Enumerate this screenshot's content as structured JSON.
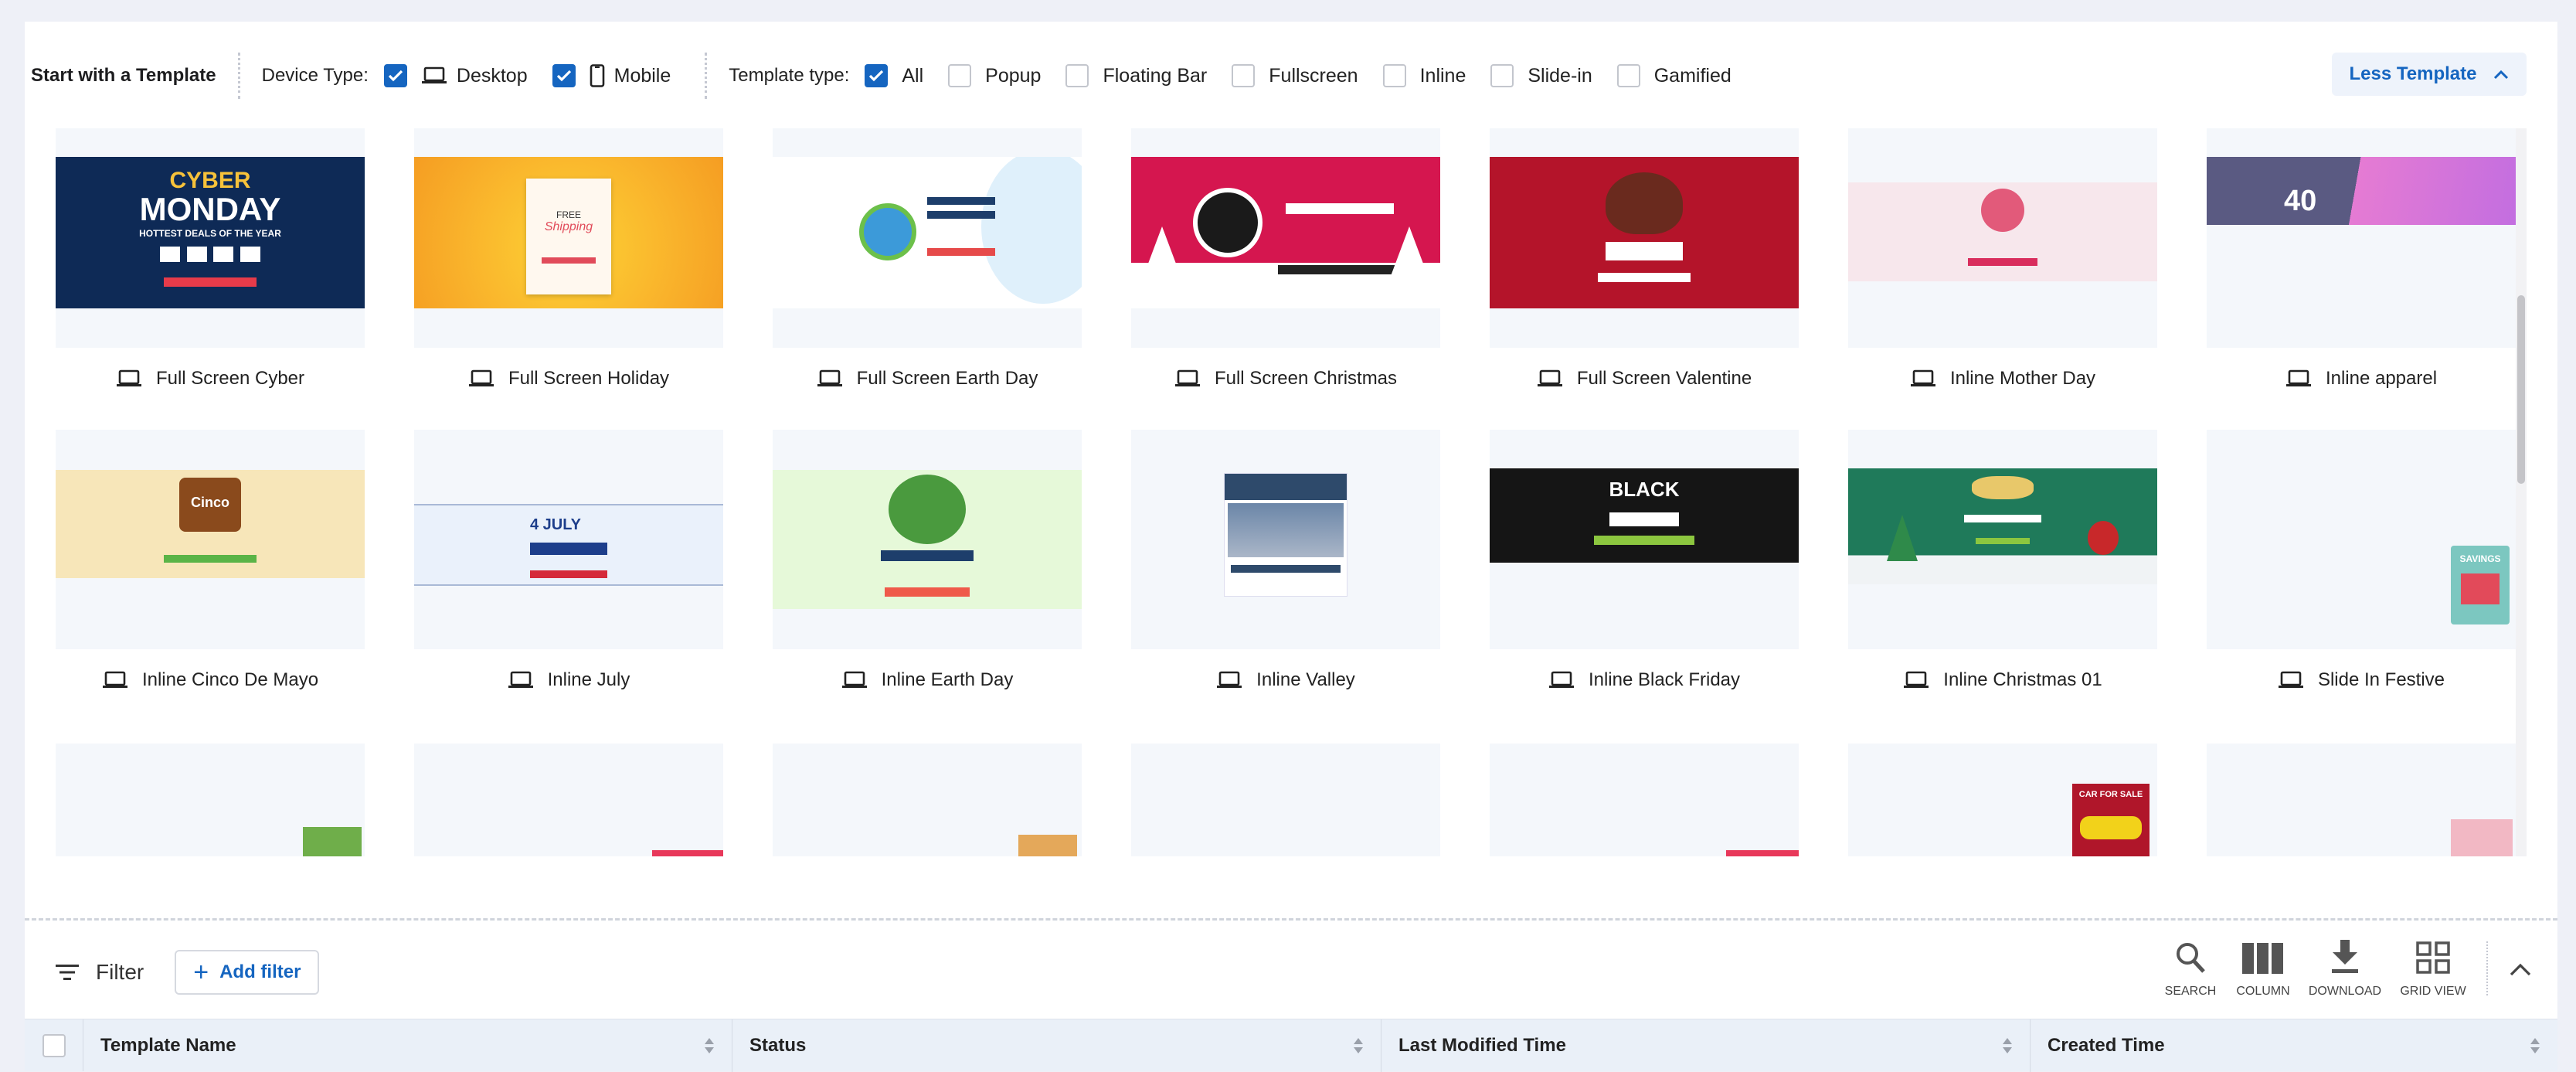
{
  "topbar": {
    "title": "Start with a Template",
    "device_label": "Device Type:",
    "device_options": [
      {
        "label": "Desktop",
        "checked": true,
        "icon": "laptop-icon"
      },
      {
        "label": "Mobile",
        "checked": true,
        "icon": "phone-icon"
      }
    ],
    "template_label": "Template type:",
    "template_options": [
      {
        "label": "All",
        "checked": true
      },
      {
        "label": "Popup",
        "checked": false
      },
      {
        "label": "Floating Bar",
        "checked": false
      },
      {
        "label": "Fullscreen",
        "checked": false
      },
      {
        "label": "Inline",
        "checked": false
      },
      {
        "label": "Slide-in",
        "checked": false
      },
      {
        "label": "Gamified",
        "checked": false
      }
    ],
    "less_button": "Less Template"
  },
  "templates": [
    {
      "name": "Full Screen Cyber",
      "icon": "laptop-icon"
    },
    {
      "name": "Full Screen Holiday",
      "icon": "laptop-icon"
    },
    {
      "name": "Full Screen Earth Day",
      "icon": "laptop-icon"
    },
    {
      "name": "Full Screen Christmas",
      "icon": "laptop-icon"
    },
    {
      "name": "Full Screen Valentine",
      "icon": "laptop-icon"
    },
    {
      "name": "Inline Mother Day",
      "icon": "laptop-icon"
    },
    {
      "name": "Inline apparel",
      "icon": "laptop-icon"
    },
    {
      "name": "Inline Cinco De Mayo",
      "icon": "laptop-icon"
    },
    {
      "name": "Inline July",
      "icon": "laptop-icon"
    },
    {
      "name": "Inline Earth Day",
      "icon": "laptop-icon"
    },
    {
      "name": "Inline Valley",
      "icon": "laptop-icon"
    },
    {
      "name": "Inline Black Friday",
      "icon": "laptop-icon"
    },
    {
      "name": "Inline Christmas 01",
      "icon": "laptop-icon"
    },
    {
      "name": "Slide In Festive",
      "icon": "laptop-icon"
    }
  ],
  "thumb_texts": {
    "cyber_1": "CYBER",
    "cyber_2": "MONDAY",
    "cyber_3": "HOTTEST DEALS OF THE YEAR",
    "holiday_1": "FREE",
    "holiday_2": "Shipping",
    "apparel": "40",
    "cinco": "Cinco",
    "july": "4 JULY",
    "black": "BLACK",
    "savings": "SAVINGS",
    "car": "CAR FOR SALE"
  },
  "colors": {
    "accent": "#1565c0",
    "cyber": "#0e2a56",
    "holiday": "#f8b62d",
    "christmas": "#d5164f",
    "valentine": "#b4142a",
    "mother": "#f7e7ec",
    "apparel": "#5a5a82",
    "cinco": "#f7e6b9",
    "earth_inline": "#e6f9d9",
    "black_friday": "#151515",
    "christmas01": "#1f7a5a"
  },
  "filter": {
    "label": "Filter",
    "add_label": "Add filter"
  },
  "toolbar": [
    {
      "label": "SEARCH",
      "icon": "search-icon"
    },
    {
      "label": "COLUMN",
      "icon": "column-icon"
    },
    {
      "label": "DOWNLOAD",
      "icon": "download-icon"
    },
    {
      "label": "GRID VIEW",
      "icon": "grid-view-icon"
    }
  ],
  "table": {
    "columns": [
      "Template Name",
      "Status",
      "Last Modified Time",
      "Created Time"
    ]
  }
}
